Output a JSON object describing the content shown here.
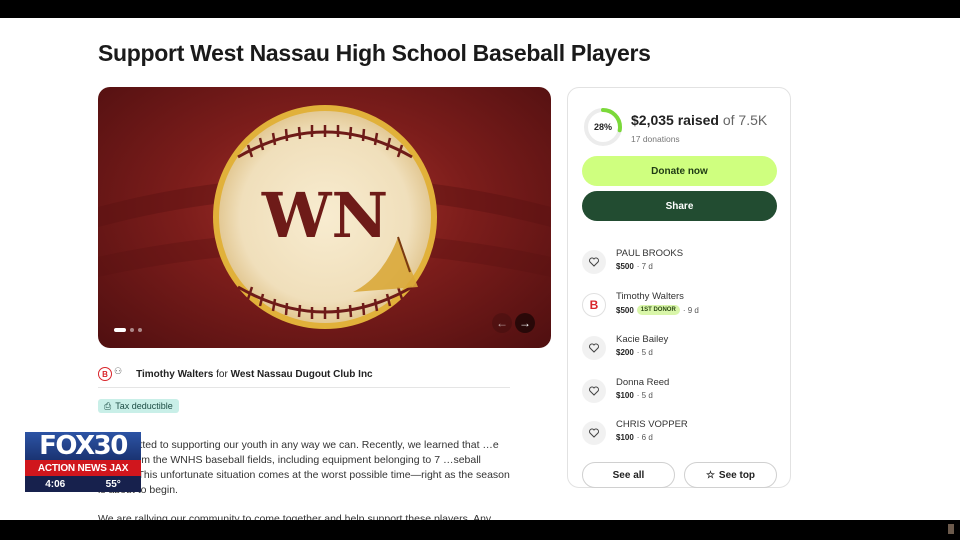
{
  "page": {
    "title": "Support West Nassau High School Baseball Players"
  },
  "hero": {
    "logo_text": "WN",
    "carousel_count": 3,
    "carousel_active": 1
  },
  "organizer": {
    "name": "Timothy Walters",
    "connector": "for",
    "org": "West Nassau Dugout Club Inc",
    "avatar_letter": "B"
  },
  "tax_badge": "Tax deductible",
  "story": {
    "p1": "…committed to supporting our youth in any way we can. Recently, we learned that …e stolen from the WNHS baseball fields, including equipment belonging to 7 …seball players. This unfortunate situation comes at the worst possible time—right as the season is about to begin.",
    "p2": "We are rallying our community to come together and help support these players. Any"
  },
  "card": {
    "progress_pct": "28%",
    "progress_value": 0.28,
    "raised_amount": "$2,035 raised",
    "goal": "of 7.5K",
    "donations_count": "17 donations",
    "donate_label": "Donate now",
    "share_label": "Share",
    "see_all_label": "See all",
    "see_top_label": "See top",
    "donors": [
      {
        "name": "PAUL BROOKS",
        "amount": "$500",
        "time": "· 7 d",
        "badge": ""
      },
      {
        "name": "Timothy Walters",
        "amount": "$500",
        "time": "· 9 d",
        "badge": "1ST DONOR"
      },
      {
        "name": "Kacie Bailey",
        "amount": "$200",
        "time": "· 5 d",
        "badge": ""
      },
      {
        "name": "Donna Reed",
        "amount": "$100",
        "time": "· 5 d",
        "badge": ""
      },
      {
        "name": "CHRIS VOPPER",
        "amount": "$100",
        "time": "· 6 d",
        "badge": ""
      }
    ]
  },
  "news": {
    "logo": "FOX30",
    "bar": "ACTION NEWS JAX",
    "time": "4:06",
    "temp": "55°"
  },
  "colors": {
    "donate": "#cfff7f",
    "share": "#224c31",
    "progress": "#7bd93a"
  }
}
